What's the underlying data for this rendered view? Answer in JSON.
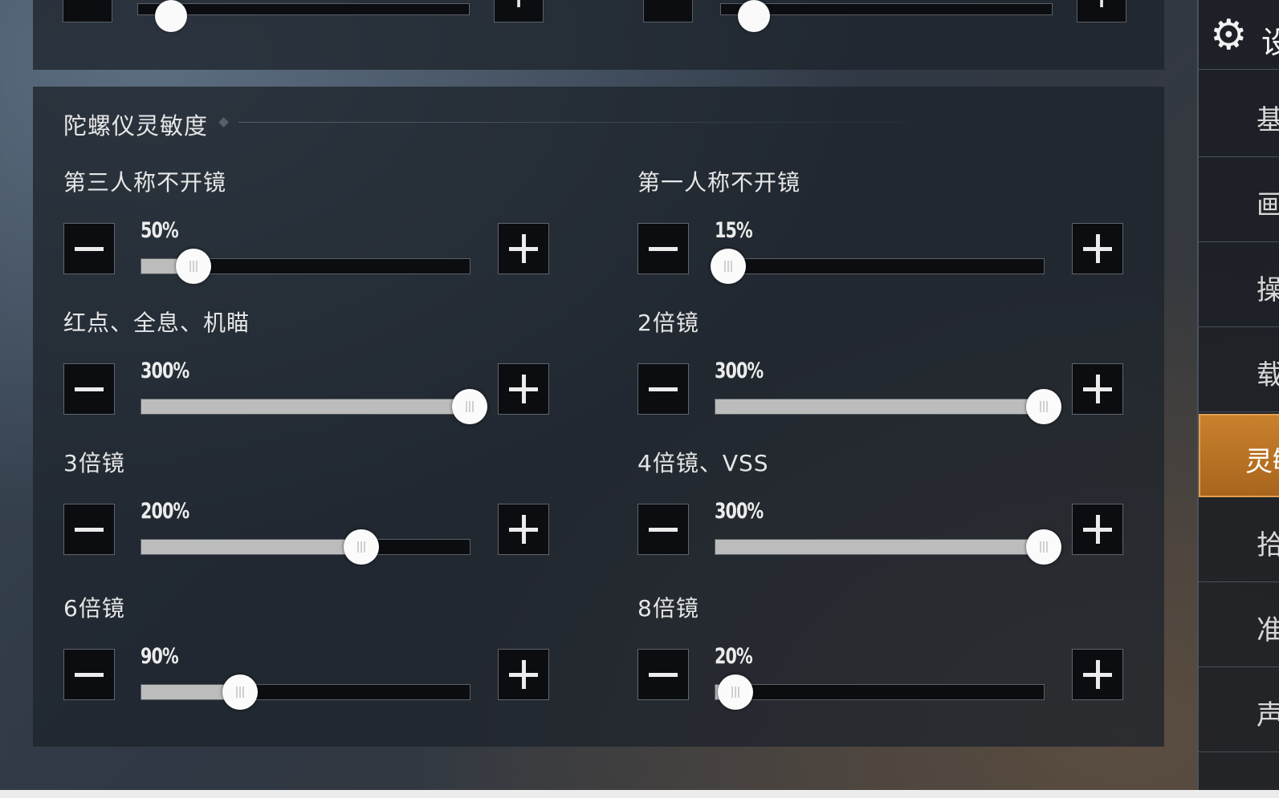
{
  "top_partial_row": {
    "left": {
      "minus": "−",
      "plus": "+",
      "percent": 5
    },
    "right": {
      "minus": "−",
      "plus": "+",
      "percent": 5
    }
  },
  "section": {
    "title": "陀螺仪灵敏度"
  },
  "settings": [
    {
      "label": "第三人称不开镜",
      "value": "50%",
      "percent": 16
    },
    {
      "label": "第一人称不开镜",
      "value": "15%",
      "percent": 4
    },
    {
      "label": "红点、全息、机瞄",
      "value": "300%",
      "percent": 100
    },
    {
      "label": "2倍镜",
      "value": "300%",
      "percent": 100
    },
    {
      "label": "3倍镜",
      "value": "200%",
      "percent": 67
    },
    {
      "label": "4倍镜、VSS",
      "value": "300%",
      "percent": 100
    },
    {
      "label": "6倍镜",
      "value": "90%",
      "percent": 30
    },
    {
      "label": "8倍镜",
      "value": "20%",
      "percent": 6
    }
  ],
  "sidebar": {
    "title": "设",
    "items": [
      "基",
      "画",
      "操",
      "载",
      "灵敏",
      "拾",
      "准",
      "声"
    ],
    "active_index": 4
  },
  "colors": {
    "accent": "#c9812d",
    "track_fill": "#bcbcbc"
  }
}
